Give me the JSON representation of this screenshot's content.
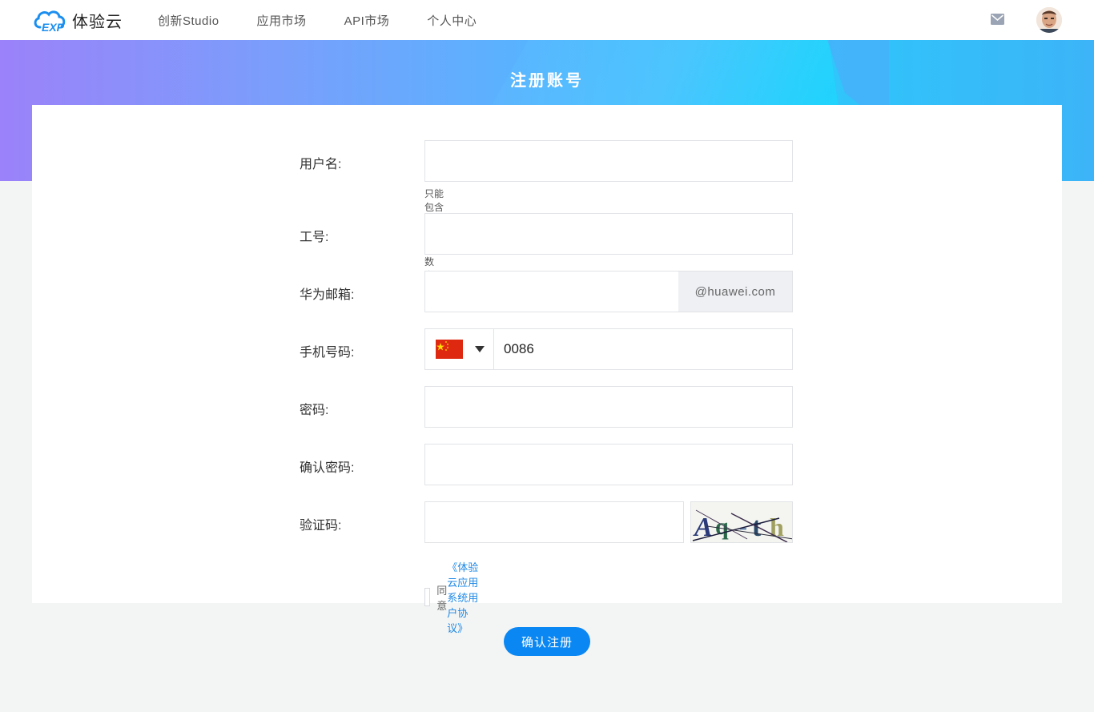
{
  "header": {
    "logo_text": "体验云",
    "nav": [
      {
        "label": "创新Studio"
      },
      {
        "label": "应用市场"
      },
      {
        "label": "API市场"
      },
      {
        "label": "个人中心"
      }
    ]
  },
  "banner": {
    "title": "注册账号"
  },
  "form": {
    "username": {
      "label": "用户名:",
      "value": "",
      "hint": "只能包含小写字母、数字、下划线"
    },
    "employee_id": {
      "label": "工号:",
      "value": ""
    },
    "email": {
      "label": "华为邮箱:",
      "value": "",
      "suffix": "@huawei.com"
    },
    "phone": {
      "label": "手机号码:",
      "country_code": "0086",
      "country_flag": "china-flag-icon"
    },
    "password": {
      "label": "密码:",
      "value": ""
    },
    "confirm_password": {
      "label": "确认密码:",
      "value": ""
    },
    "captcha": {
      "label": "验证码:",
      "value": "",
      "image_text": "Aq-th"
    },
    "agreement": {
      "prefix": "同意",
      "link": "《体验云应用系统用户协议》",
      "checked": false
    }
  },
  "submit_label": "确认注册",
  "colors": {
    "accent": "#0a87f2",
    "link": "#1e88e5",
    "banner_left": "#9b82fa",
    "banner_right": "#3cb4f7"
  }
}
